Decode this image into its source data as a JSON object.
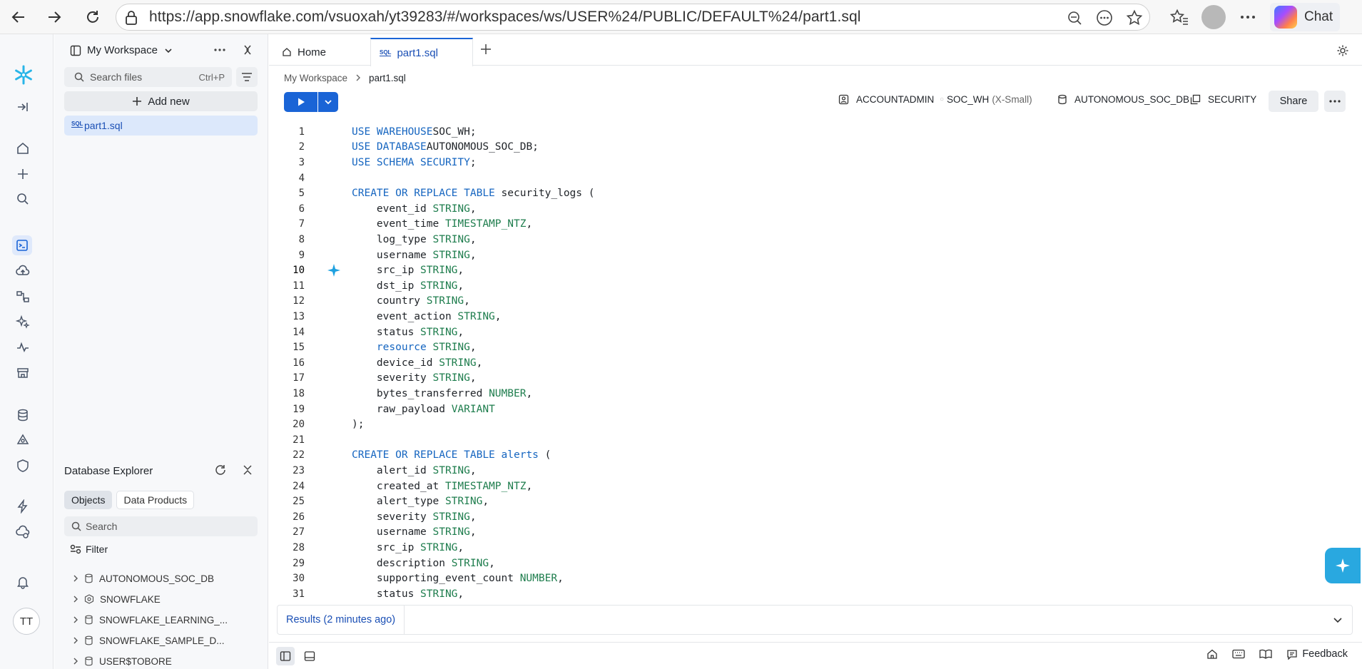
{
  "browser": {
    "url": "https://app.snowflake.com/vsuoxah/yt39283/#/workspaces/ws/USER%24/PUBLIC/DEFAULT%24/part1.sql",
    "chat_label": "Chat"
  },
  "workspace": {
    "title": "My Workspace",
    "search_placeholder": "Search files",
    "search_shortcut": "Ctrl+P",
    "add_new_label": "Add new",
    "files": [
      {
        "name": "part1.sql"
      }
    ]
  },
  "database_explorer": {
    "title": "Database Explorer",
    "tabs": [
      "Objects",
      "Data Products"
    ],
    "search_placeholder": "Search",
    "filter_label": "Filter",
    "items": [
      {
        "name": "AUTONOMOUS_SOC_DB",
        "icon": "database-icon"
      },
      {
        "name": "SNOWFLAKE",
        "icon": "shared-database-icon"
      },
      {
        "name": "SNOWFLAKE_LEARNING_...",
        "icon": "database-icon"
      },
      {
        "name": "SNOWFLAKE_SAMPLE_D...",
        "icon": "database-icon"
      },
      {
        "name": "USER$TOBORE",
        "icon": "database-icon"
      }
    ]
  },
  "rail": {
    "avatar_initials": "TT"
  },
  "editor": {
    "tabs": [
      {
        "label": "Home"
      },
      {
        "label": "part1.sql"
      }
    ],
    "breadcrumb": [
      "My Workspace",
      "part1.sql"
    ],
    "context": {
      "role": "ACCOUNTADMIN",
      "warehouse": "SOC_WH",
      "warehouse_size": "(X-Small)",
      "database": "AUTONOMOUS_SOC_DB",
      "schema": "SECURITY"
    },
    "share_label": "Share",
    "active_line": 10,
    "lines": [
      [
        [
          "kw",
          "USE WAREHOUSE"
        ],
        [
          "",
          "SOC_WH;"
        ]
      ],
      [
        [
          "kw",
          "USE DATABASE"
        ],
        [
          "",
          "AUTONOMOUS_SOC_DB;"
        ]
      ],
      [
        [
          "kw",
          "USE SCHEMA SECURITY"
        ],
        [
          "",
          ";"
        ]
      ],
      [],
      [
        [
          "kw",
          "CREATE OR REPLACE TABLE"
        ],
        [
          "",
          " security_logs ("
        ]
      ],
      [
        [
          "",
          "    event_id "
        ],
        [
          "ty",
          "STRING"
        ],
        [
          "",
          ","
        ]
      ],
      [
        [
          "",
          "    event_time "
        ],
        [
          "ty",
          "TIMESTAMP_NTZ"
        ],
        [
          "",
          ","
        ]
      ],
      [
        [
          "",
          "    log_type "
        ],
        [
          "ty",
          "STRING"
        ],
        [
          "",
          ","
        ]
      ],
      [
        [
          "",
          "    username "
        ],
        [
          "ty",
          "STRING"
        ],
        [
          "",
          ","
        ]
      ],
      [
        [
          "",
          "    src_ip "
        ],
        [
          "ty",
          "STRING"
        ],
        [
          "",
          ","
        ]
      ],
      [
        [
          "",
          "    dst_ip "
        ],
        [
          "ty",
          "STRING"
        ],
        [
          "",
          ","
        ]
      ],
      [
        [
          "",
          "    country "
        ],
        [
          "ty",
          "STRING"
        ],
        [
          "",
          ","
        ]
      ],
      [
        [
          "",
          "    event_action "
        ],
        [
          "ty",
          "STRING"
        ],
        [
          "",
          ","
        ]
      ],
      [
        [
          "",
          "    status "
        ],
        [
          "ty",
          "STRING"
        ],
        [
          "",
          ","
        ]
      ],
      [
        [
          "",
          "    "
        ],
        [
          "kw",
          "resource"
        ],
        [
          "",
          " "
        ],
        [
          "ty",
          "STRING"
        ],
        [
          "",
          ","
        ]
      ],
      [
        [
          "",
          "    device_id "
        ],
        [
          "ty",
          "STRING"
        ],
        [
          "",
          ","
        ]
      ],
      [
        [
          "",
          "    severity "
        ],
        [
          "ty",
          "STRING"
        ],
        [
          "",
          ","
        ]
      ],
      [
        [
          "",
          "    bytes_transferred "
        ],
        [
          "ty",
          "NUMBER"
        ],
        [
          "",
          ","
        ]
      ],
      [
        [
          "",
          "    raw_payload "
        ],
        [
          "ty",
          "VARIANT"
        ]
      ],
      [
        [
          "",
          ");"
        ]
      ],
      [],
      [
        [
          "kw",
          "CREATE OR REPLACE TABLE"
        ],
        [
          "",
          " "
        ],
        [
          "kw",
          "alerts"
        ],
        [
          "",
          " ("
        ]
      ],
      [
        [
          "",
          "    alert_id "
        ],
        [
          "ty",
          "STRING"
        ],
        [
          "",
          ","
        ]
      ],
      [
        [
          "",
          "    created_at "
        ],
        [
          "ty",
          "TIMESTAMP_NTZ"
        ],
        [
          "",
          ","
        ]
      ],
      [
        [
          "",
          "    alert_type "
        ],
        [
          "ty",
          "STRING"
        ],
        [
          "",
          ","
        ]
      ],
      [
        [
          "",
          "    severity "
        ],
        [
          "ty",
          "STRING"
        ],
        [
          "",
          ","
        ]
      ],
      [
        [
          "",
          "    username "
        ],
        [
          "ty",
          "STRING"
        ],
        [
          "",
          ","
        ]
      ],
      [
        [
          "",
          "    src_ip "
        ],
        [
          "ty",
          "STRING"
        ],
        [
          "",
          ","
        ]
      ],
      [
        [
          "",
          "    description "
        ],
        [
          "ty",
          "STRING"
        ],
        [
          "",
          ","
        ]
      ],
      [
        [
          "",
          "    supporting_event_count "
        ],
        [
          "ty",
          "NUMBER"
        ],
        [
          "",
          ","
        ]
      ],
      [
        [
          "",
          "    status "
        ],
        [
          "ty",
          "STRING"
        ],
        [
          "",
          ","
        ]
      ]
    ],
    "results_label": "Results (2 minutes ago)",
    "feedback_label": "Feedback"
  }
}
